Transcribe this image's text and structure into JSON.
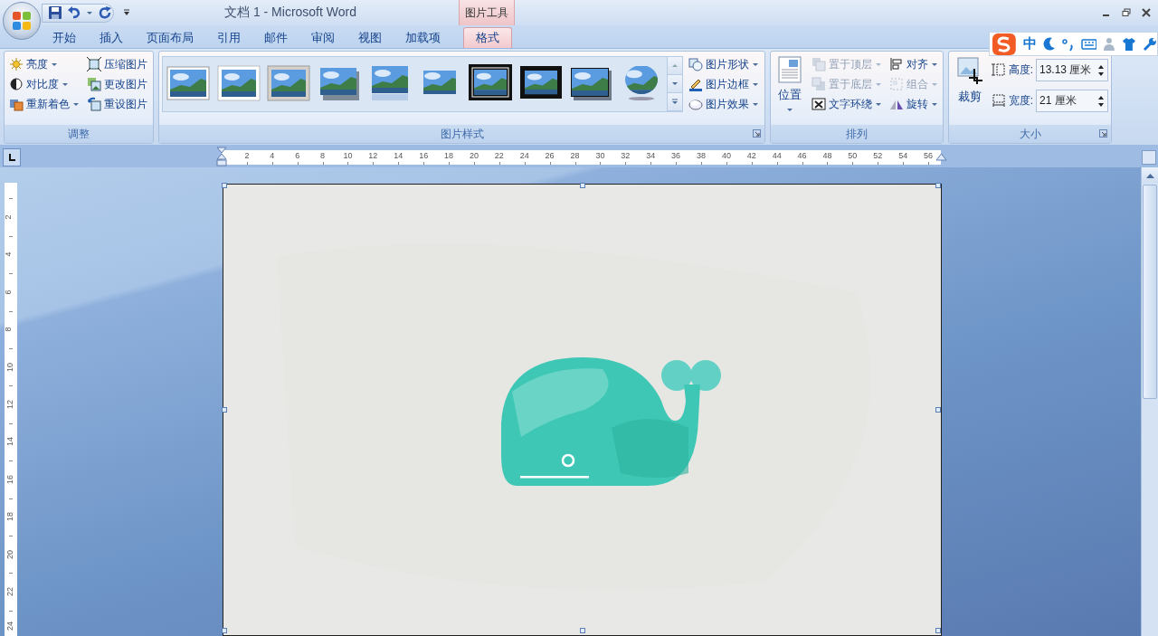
{
  "title_bar": {
    "title": "文档 1 - Microsoft Word",
    "contextual_tab": "图片工具"
  },
  "tabs": [
    {
      "label": "开始",
      "selected": false
    },
    {
      "label": "插入",
      "selected": false
    },
    {
      "label": "页面布局",
      "selected": false
    },
    {
      "label": "引用",
      "selected": false
    },
    {
      "label": "邮件",
      "selected": false
    },
    {
      "label": "审阅",
      "selected": false
    },
    {
      "label": "视图",
      "selected": false
    },
    {
      "label": "加载项",
      "selected": false
    },
    {
      "label": "格式",
      "selected": true
    }
  ],
  "ribbon": [
    {
      "title": "调整",
      "launcher": false,
      "columns": [
        [
          {
            "label": "亮度",
            "dropdown": true,
            "disabled": false
          },
          {
            "label": "对比度",
            "dropdown": true,
            "disabled": false
          },
          {
            "label": "重新着色",
            "dropdown": true,
            "disabled": false
          }
        ],
        [
          {
            "label": "压缩图片",
            "dropdown": false,
            "disabled": false
          },
          {
            "label": "更改图片",
            "dropdown": false,
            "disabled": false
          },
          {
            "label": "重设图片",
            "dropdown": false,
            "disabled": false
          }
        ]
      ]
    },
    {
      "title": "图片样式",
      "launcher": true,
      "gallery": [
        {
          "kind": "thin"
        },
        {
          "kind": "thick-white"
        },
        {
          "kind": "bevel"
        },
        {
          "kind": "shadow"
        },
        {
          "kind": "reflected"
        },
        {
          "kind": "soft-edge"
        },
        {
          "kind": "double-black"
        },
        {
          "kind": "thick-black"
        },
        {
          "kind": "black-shadow"
        },
        {
          "kind": "oval"
        }
      ],
      "columns": [
        [
          {
            "label": "图片形状",
            "dropdown": true,
            "disabled": false
          },
          {
            "label": "图片边框",
            "dropdown": true,
            "disabled": false
          },
          {
            "label": "图片效果",
            "dropdown": true,
            "disabled": false
          }
        ]
      ]
    },
    {
      "title": "排列",
      "launcher": false,
      "big_button": {
        "label": "位置",
        "dropdown": true
      },
      "columns": [
        [
          {
            "label": "置于顶层",
            "dropdown": true,
            "disabled": true
          },
          {
            "label": "置于底层",
            "dropdown": true,
            "disabled": true
          },
          {
            "label": "文字环绕",
            "dropdown": true,
            "disabled": false
          }
        ],
        [
          {
            "label": "对齐",
            "dropdown": true,
            "disabled": false
          },
          {
            "label": "组合",
            "dropdown": true,
            "disabled": true
          },
          {
            "label": "旋转",
            "dropdown": true,
            "disabled": false
          }
        ]
      ]
    },
    {
      "title": "大小",
      "launcher": true,
      "big_button": {
        "label": "裁剪",
        "dropdown": false
      },
      "fields": [
        {
          "label": "高度:",
          "value": "13.13 厘米"
        },
        {
          "label": "宽度:",
          "value": "21 厘米"
        }
      ]
    }
  ],
  "ime_toolbar": {
    "mode": "中"
  },
  "horizontal_ruler": {
    "numbers": [
      "2",
      "4",
      "6",
      "8",
      "10",
      "12",
      "14",
      "16",
      "18",
      "20",
      "22",
      "24",
      "26",
      "28",
      "30",
      "32",
      "34",
      "36",
      "38",
      "40",
      "42",
      "44",
      "46",
      "48",
      "50",
      "52",
      "54",
      "56"
    ]
  },
  "vertical_ruler": {
    "numbers": [
      "2",
      "4",
      "6",
      "8",
      "10",
      "12",
      "14",
      "16",
      "18",
      "20",
      "22",
      "24"
    ]
  },
  "document": {
    "kind": "picture",
    "selected": true
  }
}
